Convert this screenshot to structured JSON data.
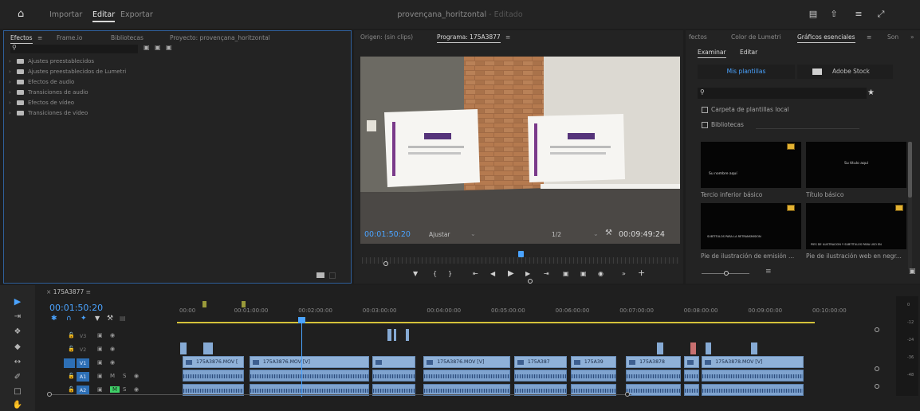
{
  "topbar": {
    "nav": [
      "Importar",
      "Editar",
      "Exportar"
    ],
    "project_name": "provençana_horitzontal",
    "project_status": "- Editado"
  },
  "effects_panel": {
    "tabs": [
      "Efectos",
      "Frame.io",
      "Bibliotecas",
      "Proyecto: provençana_horitzontal"
    ],
    "items": [
      "Ajustes preestablecidos",
      "Ajustes preestablecidos de Lumetri",
      "Efectos de audio",
      "Transiciones de audio",
      "Efectos de vídeo",
      "Transiciones de vídeo"
    ]
  },
  "program_monitor": {
    "tabs": [
      "Origen: (sin clips)",
      "Programa: 175A3877"
    ],
    "current_time": "00:01:50:20",
    "fit_label": "Ajustar",
    "resolution": "1/2",
    "duration": "00:09:49:24",
    "playhead_fraction": 0.19
  },
  "graphics_panel": {
    "tabs": [
      "fectos",
      "Color de Lumetri",
      "Gráficos esenciales",
      "Son"
    ],
    "subtabs": [
      "Examinar",
      "Editar"
    ],
    "my_templates": "Mis plantillas",
    "adobe_stock": "Adobe Stock",
    "local_folder": "Carpeta de plantillas local",
    "libraries": "Bibliotecas",
    "templates": [
      {
        "label": "Tercio inferior básico",
        "preview_text": "Su nombre aquí"
      },
      {
        "label": "Título básico",
        "preview_text": "Su título aquí"
      },
      {
        "label": "Pie de ilustración de emisión ...",
        "preview_text": "SUBTÍTULOS PARA LA RETRANSMISIÓN"
      },
      {
        "label": "Pie de ilustración web en negr...",
        "preview_text": "PIES DE ILUSTRACIÓN Y SUBTÍTULOS PARA USO EN"
      }
    ]
  },
  "timeline": {
    "sequence_tab": "175A3877",
    "current_time": "00:01:50:20",
    "ruler": [
      "00:00",
      "00:01:00:00",
      "00:02:00:00",
      "00:03:00:00",
      "00:04:00:00",
      "00:05:00:00",
      "00:06:00:00",
      "00:07:00:00",
      "00:08:00:00",
      "00:09:00:00",
      "00:10:00:00"
    ],
    "tracks": [
      {
        "name": "V3",
        "type": "video"
      },
      {
        "name": "V2",
        "type": "video"
      },
      {
        "name": "V1",
        "type": "video",
        "active": true
      },
      {
        "name": "A1",
        "type": "audio",
        "active": true
      },
      {
        "name": "A2",
        "type": "audio",
        "active": true
      }
    ],
    "video_clips": [
      {
        "label": "175A3876.MOV [",
        "start": 0.0,
        "end": 0.96
      },
      {
        "label": "175A3876.MOV [V]",
        "start": 1.04,
        "end": 2.9
      },
      {
        "label": "",
        "start": 2.95,
        "end": 3.62
      },
      {
        "label": "175A3876.MOV [V]",
        "start": 3.75,
        "end": 5.1
      },
      {
        "label": "175A387",
        "start": 5.16,
        "end": 5.98
      },
      {
        "label": "175A39",
        "start": 6.04,
        "end": 6.75
      },
      {
        "label": "175A3878",
        "start": 6.9,
        "end": 7.76
      },
      {
        "label": "",
        "start": 7.8,
        "end": 8.04
      },
      {
        "label": "175A3878.MOV [V]",
        "start": 8.08,
        "end": 9.67
      }
    ],
    "meter_labels": [
      "0",
      "-12",
      "-24",
      "-36",
      "-48"
    ]
  }
}
